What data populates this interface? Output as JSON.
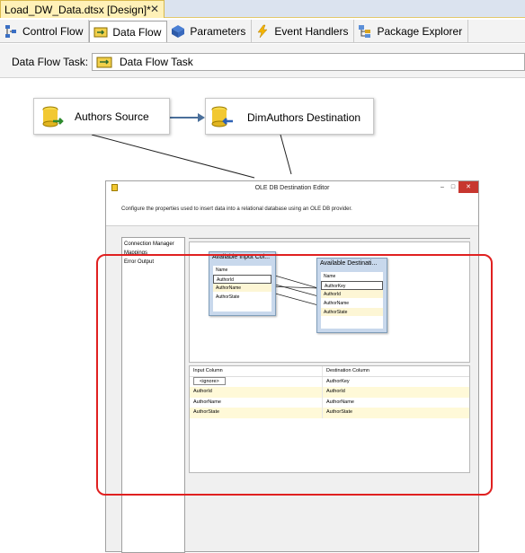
{
  "doc_tab": {
    "title": "Load_DW_Data.dtsx [Design]*",
    "close": "✕"
  },
  "designer_tabs": [
    {
      "label": "Control Flow"
    },
    {
      "label": "Data Flow"
    },
    {
      "label": "Parameters"
    },
    {
      "label": "Event Handlers"
    },
    {
      "label": "Package Explorer"
    }
  ],
  "task_selector": {
    "label": "Data Flow Task:",
    "value": "Data Flow Task"
  },
  "components": {
    "source": "Authors Source",
    "destination": "DimAuthors Destination"
  },
  "editor": {
    "title": "OLE DB Destination Editor",
    "description": "Configure the properties used to insert data into a relational database using an OLE DB provider.",
    "nav": [
      "Connection Manager",
      "Mappings",
      "Error Output"
    ],
    "input_table": {
      "title": "Available Input Col...",
      "header": "Name",
      "rows": [
        "AuthorId",
        "AuthorName",
        "AuthorState"
      ]
    },
    "dest_table": {
      "title": "Available Destinati...",
      "header": "Name",
      "rows": [
        "AuthorKey",
        "AuthorId",
        "AuthorName",
        "AuthorState"
      ]
    },
    "grid": {
      "headers": [
        "Input Column",
        "Destination Column"
      ],
      "rows": [
        [
          "<ignore>",
          "AuthorKey"
        ],
        [
          "AuthorId",
          "AuthorId"
        ],
        [
          "AuthorName",
          "AuthorName"
        ],
        [
          "AuthorState",
          "AuthorState"
        ]
      ]
    }
  },
  "colors": {
    "highlight": "#e02020",
    "active_tab": "#fff1b8"
  }
}
